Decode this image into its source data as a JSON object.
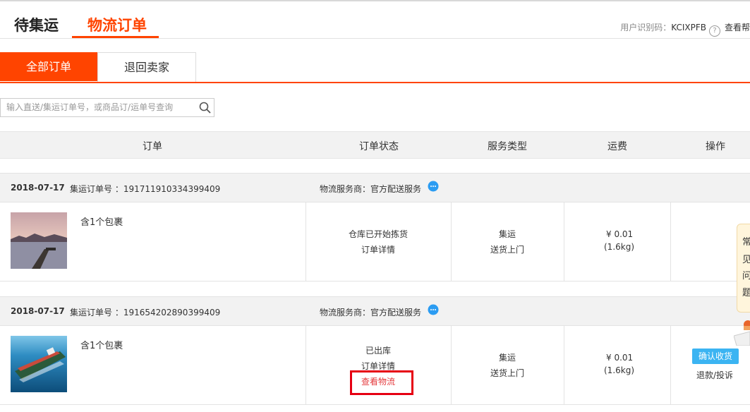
{
  "main_tabs": [
    "待集运",
    "物流订单"
  ],
  "user": {
    "label": "用户识别码：",
    "code": "KCIXPFB",
    "help_icon": "?",
    "more": "查看帮"
  },
  "sub_tabs": [
    "全部订单",
    "退回卖家"
  ],
  "search": {
    "placeholder": "输入直送/集运订单号，或商品订/运单号查询"
  },
  "table_headers": {
    "order": "订单",
    "status": "订单状态",
    "service": "服务类型",
    "fee": "运费",
    "action": "操作"
  },
  "orders": [
    {
      "date": "2018-07-17",
      "order_no_label": "集运订单号 ：",
      "order_no": "191711910334399409",
      "provider_label": "物流服务商：",
      "provider": "官方配送服务",
      "package": "含1个包裹",
      "status": "仓库已开始拣货",
      "detail": "订单详情",
      "service": "集运",
      "delivery": "送货上门",
      "price": "¥ 0.01",
      "weight": "(1.6kg)"
    },
    {
      "date": "2018-07-17",
      "order_no_label": "集运订单号 ：",
      "order_no": "191654202890399409",
      "provider_label": "物流服务商：",
      "provider": "官方配送服务",
      "package": "含1个包裹",
      "status": "已出库",
      "detail": "订单详情",
      "track": "查看物流",
      "service": "集运",
      "delivery": "送货上门",
      "price": "¥ 0.01",
      "weight": "(1.6kg)",
      "confirm": "确认收货",
      "refund": "退款/投诉"
    }
  ],
  "faq": [
    "常",
    "见",
    "问",
    "题"
  ],
  "colors": {
    "accent": "#ff4400",
    "confirm": "#3bb4f2",
    "highlight": "#e60012"
  }
}
